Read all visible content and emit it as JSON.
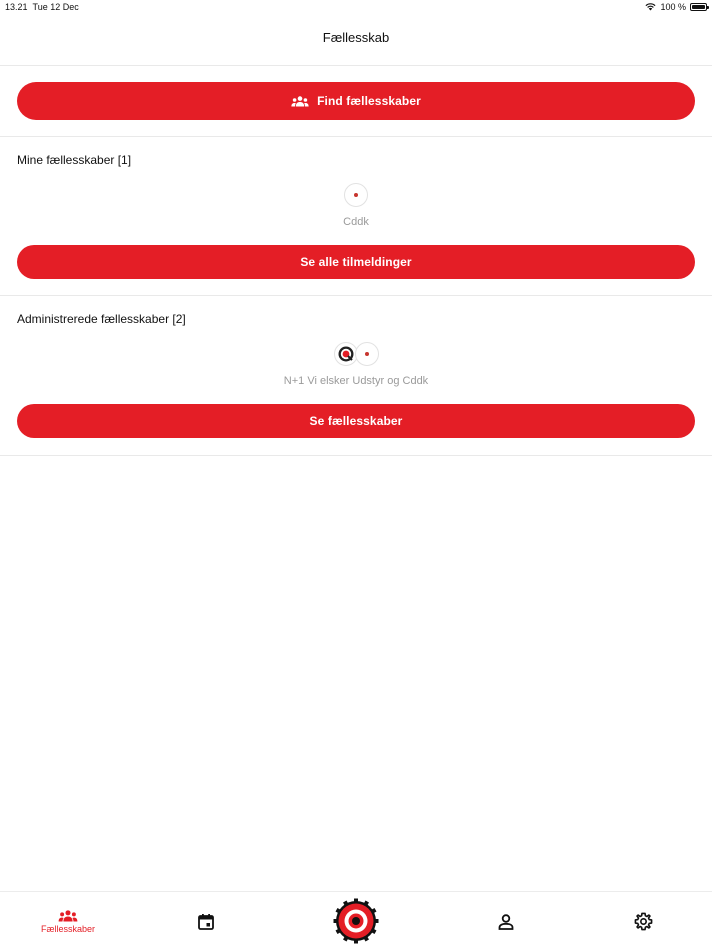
{
  "status_bar": {
    "time": "13.21",
    "date": "Tue 12 Dec",
    "battery": "100 %"
  },
  "header": {
    "title": "Fællesskab"
  },
  "find_button": {
    "label": "Find fællesskaber",
    "icon": "group-icon"
  },
  "my_communities": {
    "title": "Mine fællesskaber [1]",
    "names": "Cddk",
    "button_label": "Se alle tilmeldinger"
  },
  "admin_communities": {
    "title": "Administrerede fællesskaber [2]",
    "names": "N+1 Vi elsker Udstyr og Cddk",
    "button_label": "Se fællesskaber"
  },
  "tab_bar": {
    "items": [
      {
        "label": "Fællesskaber",
        "icon": "group-icon",
        "active": true
      },
      {
        "label": "",
        "icon": "calendar-icon",
        "active": false
      },
      {
        "label": "",
        "icon": "chainring-logo-icon",
        "active": false
      },
      {
        "label": "",
        "icon": "profile-icon",
        "active": false
      },
      {
        "label": "",
        "icon": "gear-icon",
        "active": false
      }
    ]
  },
  "colors": {
    "accent": "#e41e26",
    "muted_text": "#9a9a9a",
    "divider": "#e9e9e9"
  }
}
